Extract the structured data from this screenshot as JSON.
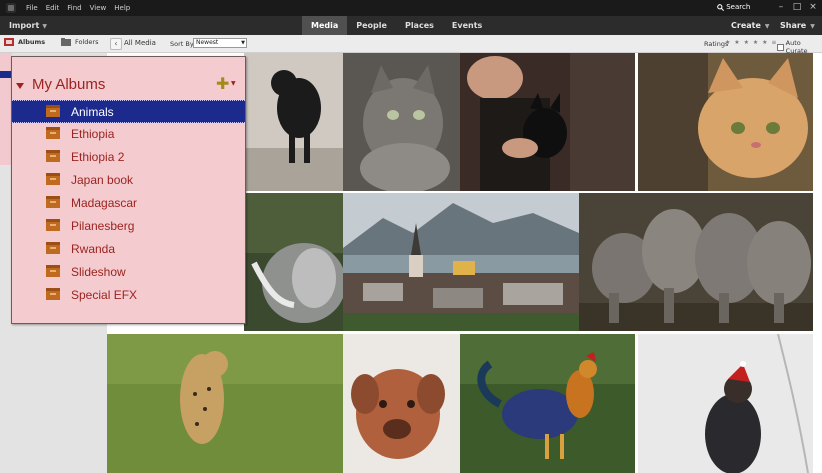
{
  "menubar": {
    "items": [
      "File",
      "Edit",
      "Find",
      "View",
      "Help"
    ],
    "search_label": "Search"
  },
  "toolbar": {
    "import_label": "Import",
    "tabs": [
      {
        "label": "Media",
        "active": true
      },
      {
        "label": "People",
        "active": false
      },
      {
        "label": "Places",
        "active": false
      },
      {
        "label": "Events",
        "active": false
      }
    ],
    "create_label": "Create",
    "share_label": "Share"
  },
  "subbar": {
    "albums_tab": "Albums",
    "folders_tab": "Folders",
    "all_media": "All Media",
    "sort_by_label": "Sort By:",
    "sort_value": "Newest",
    "ratings_label": "Ratings",
    "stars": "★ ★ ★ ★ ★ ≡",
    "auto_curate_label": "Auto Curate"
  },
  "albums_panel": {
    "title": "My Albums",
    "items": [
      {
        "label": "Animals",
        "selected": true
      },
      {
        "label": "Ethiopia",
        "selected": false
      },
      {
        "label": "Ethiopia 2",
        "selected": false
      },
      {
        "label": "Japan book",
        "selected": false
      },
      {
        "label": "Madagascar",
        "selected": false
      },
      {
        "label": "Pilanesberg",
        "selected": false
      },
      {
        "label": "Rwanda",
        "selected": false
      },
      {
        "label": "Slideshow",
        "selected": false
      },
      {
        "label": "Special EFX",
        "selected": false
      }
    ]
  },
  "colors": {
    "panel_bg": "#f4cbcf",
    "panel_text": "#9b2421",
    "selected_row": "#1b2a8c",
    "toolbar": "#2c2c2c",
    "menubar": "#1a1a1a"
  }
}
